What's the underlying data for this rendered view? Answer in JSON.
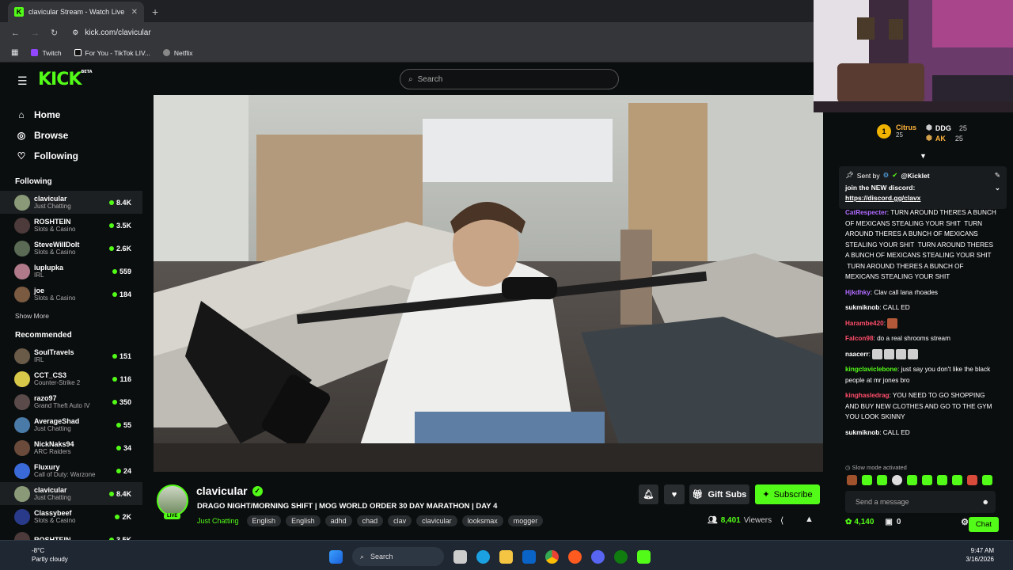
{
  "browser": {
    "tab_title": "clavicular Stream - Watch Live o",
    "url": "kick.com/clavicular",
    "bookmarks": [
      {
        "label": "Twitch",
        "color": "#9146ff"
      },
      {
        "label": "For You - TikTok LIV...",
        "color": "#ffffff"
      },
      {
        "label": "Netflix",
        "color": "#cccccc"
      }
    ]
  },
  "header": {
    "logo": "KICK",
    "logo_badge": "BETA",
    "search_placeholder": "Search"
  },
  "sidebar": {
    "nav": [
      {
        "label": "Home",
        "icon": "home-icon"
      },
      {
        "label": "Browse",
        "icon": "compass-icon"
      },
      {
        "label": "Following",
        "icon": "heart-icon"
      }
    ],
    "following_heading": "Following",
    "following": [
      {
        "name": "clavicular",
        "category": "Just Chatting",
        "viewers": "8.4K",
        "color": "#8a9a78",
        "active": true
      },
      {
        "name": "ROSHTEIN",
        "category": "Slots & Casino",
        "viewers": "3.5K",
        "color": "#4d3a3a"
      },
      {
        "name": "SteveWillDoIt",
        "category": "Slots & Casino",
        "viewers": "2.6K",
        "color": "#5a6a55"
      },
      {
        "name": "luplupka",
        "category": "IRL",
        "viewers": "559",
        "color": "#b07a8a"
      },
      {
        "name": "joe",
        "category": "Slots & Casino",
        "viewers": "184",
        "color": "#7a5a40"
      }
    ],
    "show_more": "Show More",
    "recommended_heading": "Recommended",
    "recommended": [
      {
        "name": "SoulTravels",
        "category": "IRL",
        "viewers": "151",
        "color": "#6a5a48"
      },
      {
        "name": "CCT_CS3",
        "category": "Counter-Strike 2",
        "viewers": "116",
        "color": "#d8c84a"
      },
      {
        "name": "razo97",
        "category": "Grand Theft Auto IV",
        "viewers": "350",
        "color": "#5a4a4a"
      },
      {
        "name": "AverageShad",
        "category": "Just Chatting",
        "viewers": "55",
        "color": "#4a7aa8"
      },
      {
        "name": "NickNaks94",
        "category": "ARC Raiders",
        "viewers": "34",
        "color": "#6a4a3a"
      },
      {
        "name": "Fluxury",
        "category": "Call of Duty: Warzone",
        "viewers": "24",
        "color": "#3a6ad8"
      },
      {
        "name": "clavicular",
        "category": "Just Chatting",
        "viewers": "8.4K",
        "color": "#8a9a78",
        "active": true
      },
      {
        "name": "Classybeef",
        "category": "Slots & Casino",
        "viewers": "2K",
        "color": "#2a3a8a"
      },
      {
        "name": "ROSHTEIN",
        "category": "",
        "viewers": "3.5K",
        "color": "#4d3a3a"
      }
    ]
  },
  "stream": {
    "name": "clavicular",
    "live_badge": "LIVE",
    "title": "DRAGO NIGHT/MORNING SHIFT | MOG WORLD ORDER 30 DAY MARATHON | DAY 4",
    "category": "Just Chatting",
    "tags": [
      "English",
      "English",
      "adhd",
      "chad",
      "clav",
      "clavicular",
      "looksmax",
      "mogger"
    ],
    "gift_subs": "Gift Subs",
    "subscribe": "Subscribe",
    "viewers_count": "8,401",
    "viewers_label": "Viewers"
  },
  "chat": {
    "leaders": [
      {
        "rank": "1",
        "name": "Citrus",
        "count": "25"
      },
      {
        "name": "DDG",
        "count": "25"
      },
      {
        "name": "AK",
        "count": "25"
      }
    ],
    "pinned": {
      "sent_by_label": "Sent by",
      "sender": "@Kicklet",
      "text": "join the NEW discord:",
      "link": "https://discord.gg/clavx"
    },
    "messages": [
      {
        "user": "CatRespecter",
        "color": "#b06bff",
        "text": "TURN AROUND THERES A BUNCH OF MEXICANS STEALING YOUR SHIT  TURN AROUND THERES A BUNCH OF MEXICANS STEALING YOUR SHIT  TURN AROUND THERES A BUNCH OF MEXICANS STEALING YOUR SHIT  TURN AROUND THERES A BUNCH OF MEXICANS STEALING YOUR SHIT"
      },
      {
        "user": "Hjkdhky",
        "color": "#b06bff",
        "text": "Clav call lana rhoades"
      },
      {
        "user": "sukmiknob",
        "color": "#ffffff",
        "text": "CALL ED"
      },
      {
        "user": "Harambe420",
        "color": "#ff4d6a",
        "text": ""
      },
      {
        "user": "Falcon98",
        "color": "#ff4d6a",
        "text": "do a real shrooms stream"
      },
      {
        "user": "naacerr",
        "color": "#ffffff",
        "text": ""
      },
      {
        "user": "kingclaviclebone",
        "color": "#53fc18",
        "text": "just say you don't like the black people at mr jones bro"
      },
      {
        "user": "kinghasledrag",
        "color": "#ff4d6a",
        "text": "YOU NEED TO GO SHOPPING AND BUY NEW CLOTHES AND GO TO THE GYM YOU LOOK SKINNY"
      },
      {
        "user": "sukmiknob",
        "color": "#ffffff",
        "text": "CALL ED"
      }
    ],
    "slow_mode": "Slow mode activated",
    "input_placeholder": "Send a message",
    "points": "4,140",
    "gifts": "0",
    "chat_button": "Chat"
  },
  "taskbar": {
    "temperature": "-8°C",
    "weather": "Partly cloudy",
    "search": "Search",
    "time": "9:47 AM",
    "date": "3/16/2026"
  },
  "colors": {
    "accent": "#53fc18",
    "background": "#0b0e0f"
  }
}
